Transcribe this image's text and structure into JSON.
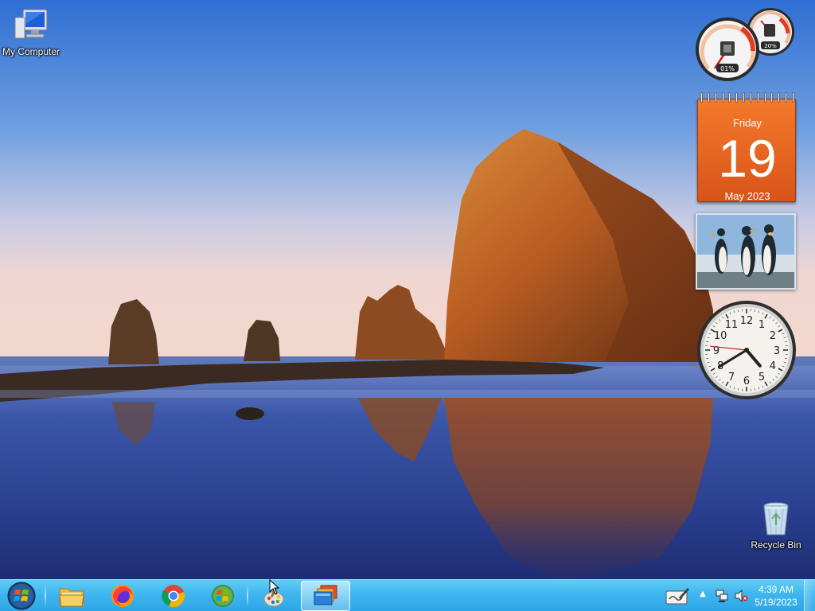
{
  "desktop": {
    "icons": [
      {
        "label": "My Computer",
        "icon": "computer-icon"
      },
      {
        "label": "Recycle Bin",
        "icon": "recycle-bin-icon"
      }
    ]
  },
  "gadgets": {
    "cpu_meter": {
      "cpu_percent_label": "01%",
      "memory_percent_label": "20%",
      "cpu_level": 0.01,
      "memory_level": 0.2
    },
    "calendar": {
      "day_name": "Friday",
      "day_number": "19",
      "month_year": "May 2023",
      "accent_color": "#e8651f"
    },
    "slideshow": {
      "subject": "penguins"
    },
    "clock": {
      "hour": 4,
      "minute": 39,
      "second": 46,
      "numerals": [
        "12",
        "1",
        "2",
        "3",
        "4",
        "5",
        "6",
        "7",
        "8",
        "9",
        "10",
        "11"
      ]
    }
  },
  "taskbar": {
    "start": {
      "icon": "windows-orb-icon"
    },
    "pinned": [
      {
        "name": "file-explorer",
        "icon": "folder-icon"
      },
      {
        "name": "firefox",
        "icon": "firefox-icon"
      },
      {
        "name": "chrome",
        "icon": "chrome-icon"
      },
      {
        "name": "windows-logo",
        "icon": "windows-logo-icon"
      },
      {
        "name": "paint",
        "icon": "paint-icon"
      },
      {
        "name": "gadgets-window",
        "icon": "gadgets-icon",
        "active": true
      }
    ],
    "tray": {
      "time": "4:39 AM",
      "date": "5/19/2023",
      "icons": [
        "tablet-pen-icon",
        "chevron-up-icon",
        "network-icon",
        "volume-muted-icon"
      ]
    },
    "color": "#3fb6ef"
  }
}
